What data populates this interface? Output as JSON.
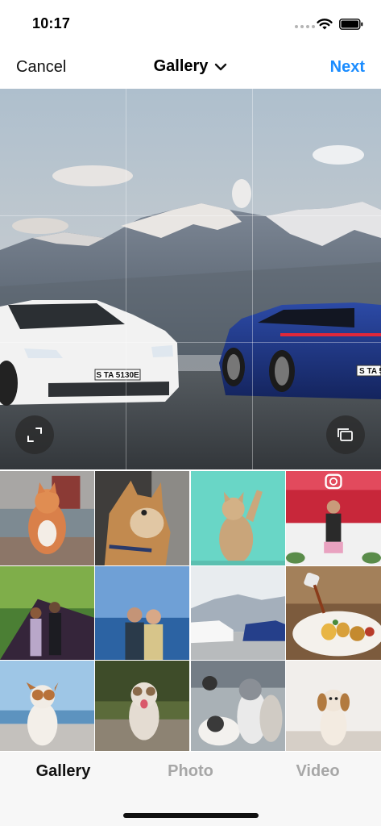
{
  "status_bar": {
    "time": "10:17",
    "icons": [
      "signal-icon",
      "wifi-icon",
      "battery-icon"
    ]
  },
  "nav": {
    "cancel_label": "Cancel",
    "title": "Gallery",
    "next_label": "Next",
    "accent_color": "#1a8cff"
  },
  "preview": {
    "subject": "two electric sports cars in front of snowy mountains",
    "plate_left": "S TA 5130E",
    "plate_right": "S TA 5",
    "expand_icon": "expand-icon",
    "multi_select_icon": "multi-select-icon"
  },
  "thumbnails": [
    "orange kitten on stone steps",
    "tabby cat with collar",
    "kitten reaching up on teal background",
    "person with cake in red room",
    "couple under tree",
    "couple by the sea",
    "cars near mountains",
    "plated dessert with sauce pour",
    "dog on rocks by the sea",
    "shaggy dog running",
    "puppies together",
    "puppy on the beach"
  ],
  "tabs": [
    {
      "label": "Gallery",
      "active": true
    },
    {
      "label": "Photo",
      "active": false
    },
    {
      "label": "Video",
      "active": false
    }
  ]
}
